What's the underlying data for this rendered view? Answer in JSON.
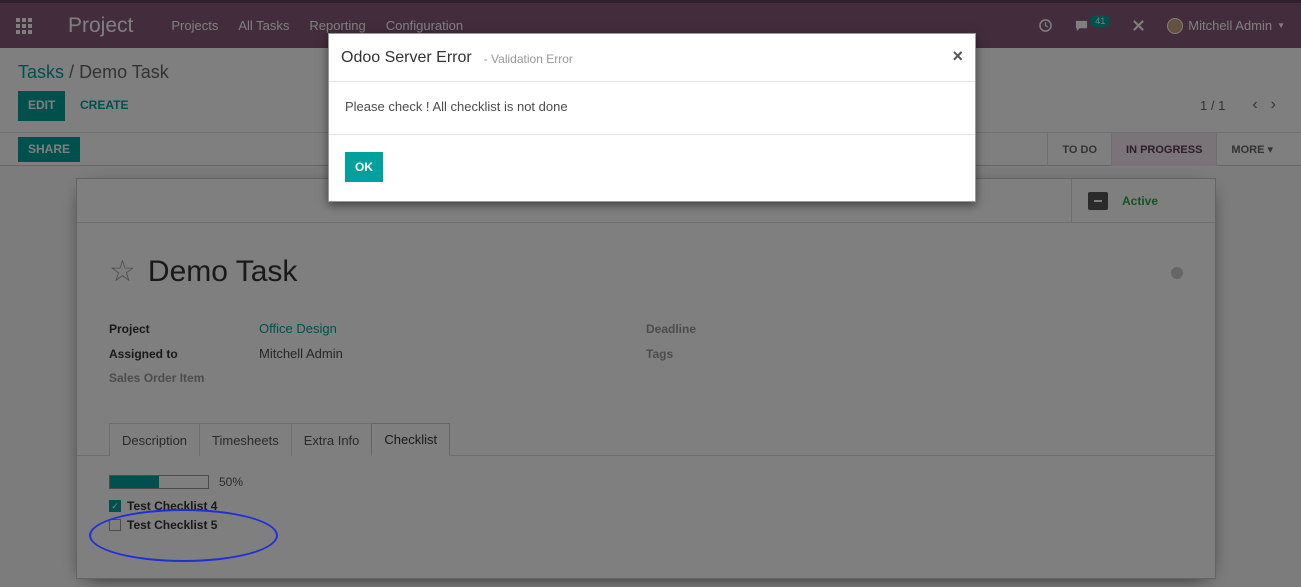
{
  "navbar": {
    "apps_icon": "apps-grid-icon",
    "brand": "Project",
    "menu": [
      "Projects",
      "All Tasks",
      "Reporting",
      "Configuration"
    ],
    "clock_icon": "clock-icon",
    "chat_icon": "chat-icon",
    "chat_badge": "41",
    "debug_icon": "bug-icon",
    "user_name": "Mitchell Admin"
  },
  "breadcrumb": {
    "parent": "Tasks",
    "separator": "/",
    "current": "Demo Task"
  },
  "buttons": {
    "edit": "EDIT",
    "create": "CREATE",
    "share": "SHARE"
  },
  "pager": {
    "value": "1 / 1",
    "prev": "‹",
    "next": "›"
  },
  "stages": [
    {
      "label": "TO DO",
      "active": false
    },
    {
      "label": "IN PROGRESS",
      "active": true
    },
    {
      "label": "MORE ▾",
      "active": false
    }
  ],
  "sheet": {
    "active_label": "Active",
    "title": "Demo Task",
    "fields_left": [
      {
        "label": "Project",
        "value": "Office Design"
      },
      {
        "label": "Assigned to",
        "value": "Mitchell Admin"
      },
      {
        "label": "Sales Order Item",
        "value": ""
      }
    ],
    "fields_right": [
      {
        "label": "Deadline"
      },
      {
        "label": "Tags"
      }
    ],
    "tabs": [
      "Description",
      "Timesheets",
      "Extra Info",
      "Checklist"
    ],
    "active_tab": "Checklist",
    "progress": {
      "percent": 50,
      "label": "50%"
    },
    "checklist": [
      {
        "label": "Test Checklist 4",
        "checked": true
      },
      {
        "label": "Test Checklist 5",
        "checked": false
      }
    ]
  },
  "modal": {
    "title": "Odoo Server Error",
    "subtitle": "- Validation Error",
    "close": "×",
    "message": "Please check ! All checklist is not done",
    "ok": "OK"
  },
  "colors": {
    "navbar": "#875a7b",
    "primary": "#00a09d",
    "annotation": "#1f2fd8"
  }
}
